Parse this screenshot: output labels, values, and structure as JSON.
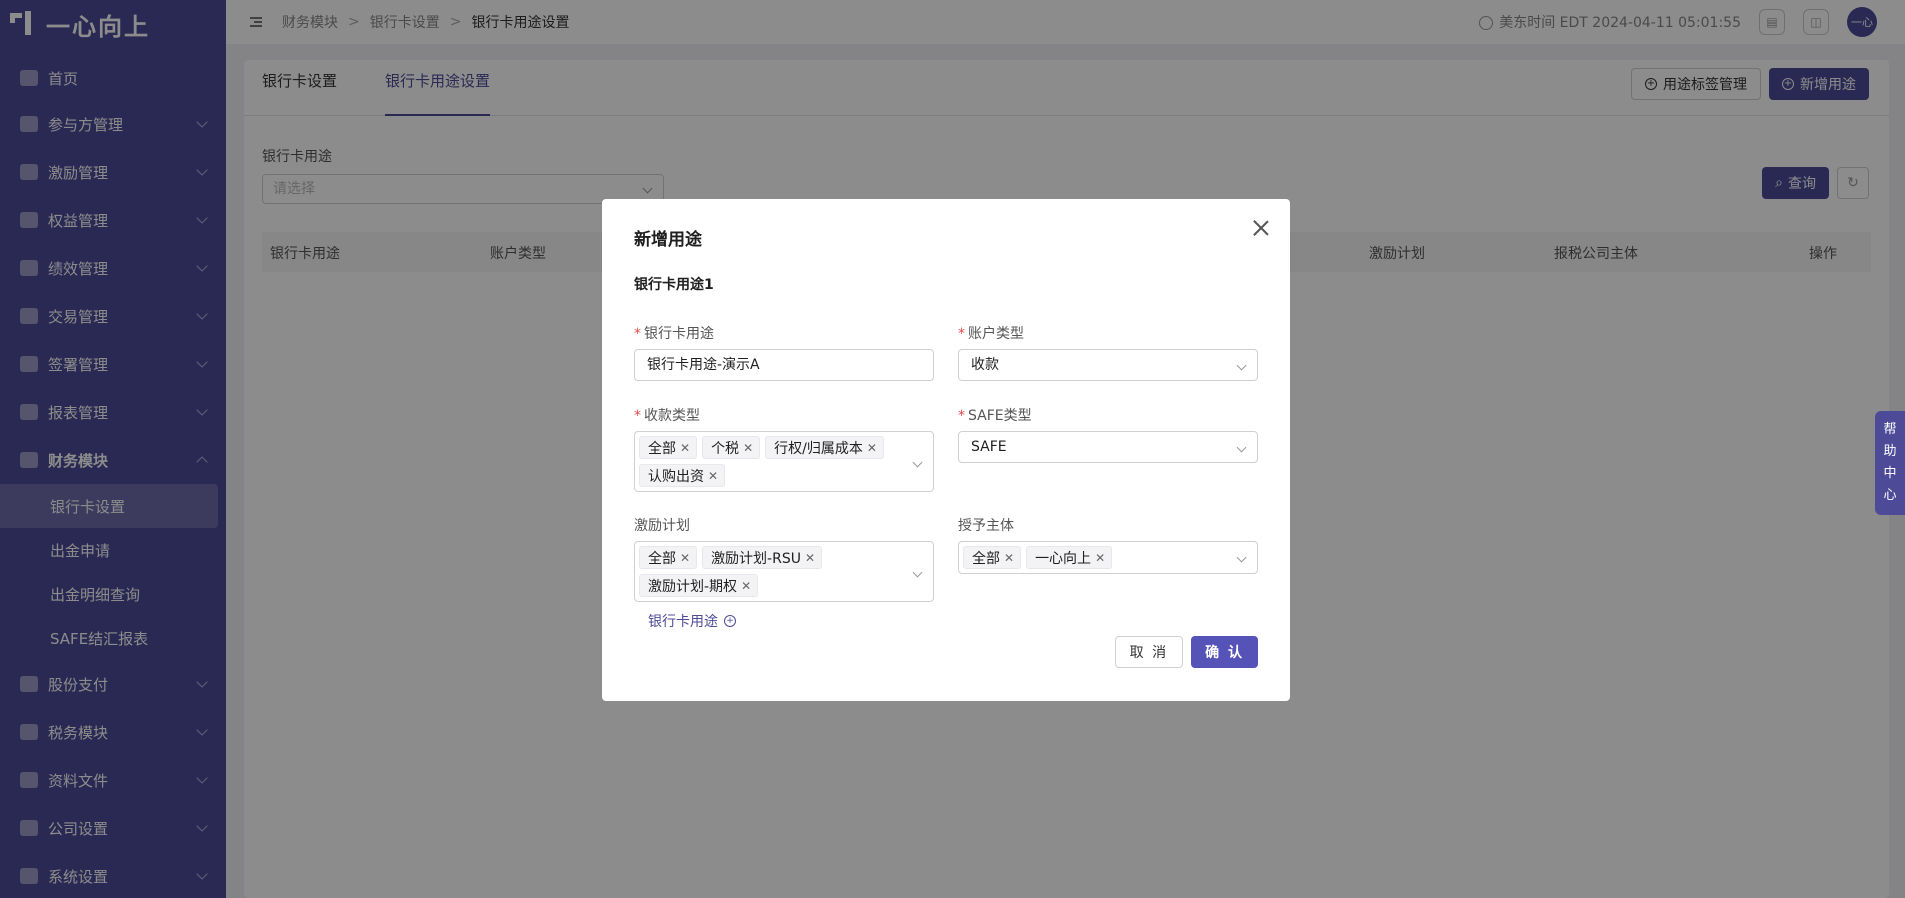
{
  "app": {
    "logo_text": "一心向上"
  },
  "sidebar": {
    "items": [
      {
        "label": "首页"
      },
      {
        "label": "参与方管理"
      },
      {
        "label": "激励管理"
      },
      {
        "label": "权益管理"
      },
      {
        "label": "绩效管理"
      },
      {
        "label": "交易管理"
      },
      {
        "label": "签署管理"
      },
      {
        "label": "报表管理"
      },
      {
        "label": "财务模块"
      },
      {
        "label": "股份支付"
      },
      {
        "label": "税务模块"
      },
      {
        "label": "资料文件"
      },
      {
        "label": "公司设置"
      },
      {
        "label": "系统设置"
      }
    ],
    "sub_items": [
      {
        "label": "银行卡设置"
      },
      {
        "label": "出金申请"
      },
      {
        "label": "出金明细查询"
      },
      {
        "label": "SAFE结汇报表"
      }
    ]
  },
  "header": {
    "breadcrumb": [
      "财务模块",
      "银行卡设置",
      "银行卡用途设置"
    ],
    "time": "美东时间 EDT 2024-04-11 05:01:55",
    "avatar": "一心"
  },
  "main": {
    "tabs": [
      {
        "label": "银行卡设置"
      },
      {
        "label": "银行卡用途设置"
      }
    ],
    "tag_manage_label": "用途标签管理",
    "add_label": "新增用途",
    "filter_label": "银行卡用途",
    "filter_placeholder": "请选择",
    "query_label": "查询",
    "columns": [
      "银行卡用途",
      "账户类型",
      "激励计划",
      "报税公司主体",
      "操作"
    ]
  },
  "modal": {
    "title": "新增用途",
    "section": "银行卡用途1",
    "usage_label": "银行卡用途",
    "usage_value": "银行卡用途-演示A",
    "account_type_label": "账户类型",
    "account_type_value": "收款",
    "receive_type_label": "收款类型",
    "receive_type_tags": [
      "全部",
      "个税",
      "行权/归属成本",
      "认购出资"
    ],
    "safe_type_label": "SAFE类型",
    "safe_type_value": "SAFE",
    "plan_label": "激励计划",
    "plan_tags": [
      "全部",
      "激励计划-RSU",
      "激励计划-期权"
    ],
    "grantor_label": "授予主体",
    "grantor_tags": [
      "全部",
      "一心向上"
    ],
    "add_usage_link": "银行卡用途",
    "cancel_label": "取 消",
    "ok_label": "确 认"
  },
  "help": {
    "chars": [
      "帮",
      "助",
      "中",
      "心"
    ]
  }
}
